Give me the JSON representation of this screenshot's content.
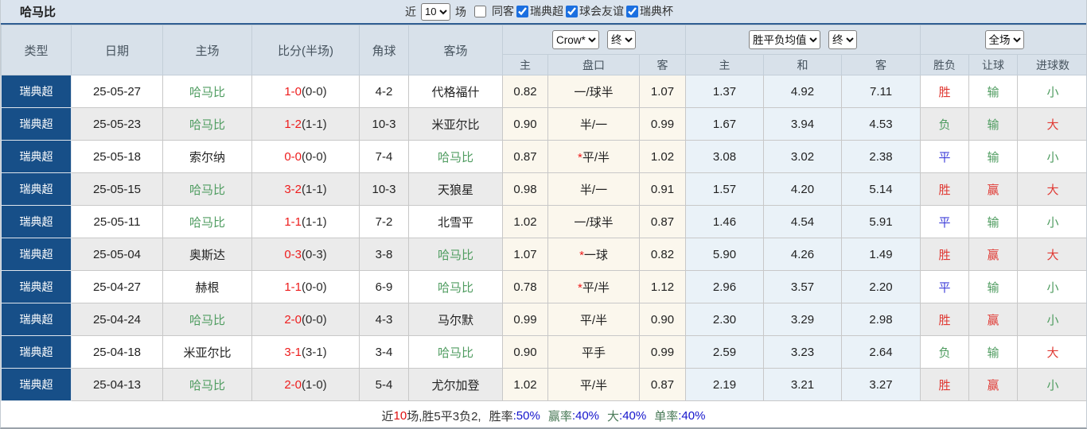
{
  "title": "哈马比",
  "topbar": {
    "recent_label": "近",
    "recent_select": "10",
    "matches_label": "场",
    "checkboxes": [
      {
        "label": "同客",
        "checked": false
      },
      {
        "label": "瑞典超",
        "checked": true
      },
      {
        "label": "球会友谊",
        "checked": true
      },
      {
        "label": "瑞典杯",
        "checked": true
      }
    ]
  },
  "table": {
    "main_headers": [
      "类型",
      "日期",
      "主场",
      "比分(半场)",
      "角球",
      "客场"
    ],
    "odds_group": {
      "select1": "Crow*",
      "select2": "终",
      "cols": [
        "主",
        "盘口",
        "客"
      ]
    },
    "mean_group": {
      "select1": "胜平负均值",
      "select2": "终",
      "cols": [
        "主",
        "和",
        "客"
      ]
    },
    "result_group": {
      "select": "全场",
      "cols": [
        "胜负",
        "让球",
        "进球数"
      ]
    },
    "rows": [
      {
        "league": "瑞典超",
        "date": "25-05-27",
        "home": "哈马比",
        "home_hl": true,
        "score_ft": "1-0",
        "score_ht": "(0-0)",
        "corners": "4-2",
        "away": "代格福什",
        "away_hl": false,
        "odds_home": "0.82",
        "handicap": "一/球半",
        "handicap_star": false,
        "odds_away": "1.07",
        "mean_home": "1.37",
        "mean_draw": "4.92",
        "mean_away": "7.11",
        "result": "胜",
        "result_color": "red",
        "handicap_result": "输",
        "handicap_result_color": "green",
        "goals": "小",
        "goals_color": "green"
      },
      {
        "league": "瑞典超",
        "date": "25-05-23",
        "home": "哈马比",
        "home_hl": true,
        "score_ft": "1-2",
        "score_ht": "(1-1)",
        "corners": "10-3",
        "away": "米亚尔比",
        "away_hl": false,
        "odds_home": "0.90",
        "handicap": "半/一",
        "handicap_star": false,
        "odds_away": "0.99",
        "mean_home": "1.67",
        "mean_draw": "3.94",
        "mean_away": "4.53",
        "result": "负",
        "result_color": "green",
        "handicap_result": "输",
        "handicap_result_color": "green",
        "goals": "大",
        "goals_color": "red"
      },
      {
        "league": "瑞典超",
        "date": "25-05-18",
        "home": "索尔纳",
        "home_hl": false,
        "score_ft": "0-0",
        "score_ht": "(0-0)",
        "corners": "7-4",
        "away": "哈马比",
        "away_hl": true,
        "odds_home": "0.87",
        "handicap": "平/半",
        "handicap_star": true,
        "odds_away": "1.02",
        "mean_home": "3.08",
        "mean_draw": "3.02",
        "mean_away": "2.38",
        "result": "平",
        "result_color": "blue",
        "handicap_result": "输",
        "handicap_result_color": "green",
        "goals": "小",
        "goals_color": "green"
      },
      {
        "league": "瑞典超",
        "date": "25-05-15",
        "home": "哈马比",
        "home_hl": true,
        "score_ft": "3-2",
        "score_ht": "(1-1)",
        "corners": "10-3",
        "away": "天狼星",
        "away_hl": false,
        "odds_home": "0.98",
        "handicap": "半/一",
        "handicap_star": false,
        "odds_away": "0.91",
        "mean_home": "1.57",
        "mean_draw": "4.20",
        "mean_away": "5.14",
        "result": "胜",
        "result_color": "red",
        "handicap_result": "赢",
        "handicap_result_color": "red",
        "goals": "大",
        "goals_color": "red"
      },
      {
        "league": "瑞典超",
        "date": "25-05-11",
        "home": "哈马比",
        "home_hl": true,
        "score_ft": "1-1",
        "score_ht": "(1-1)",
        "corners": "7-2",
        "away": "北雪平",
        "away_hl": false,
        "odds_home": "1.02",
        "handicap": "一/球半",
        "handicap_star": false,
        "odds_away": "0.87",
        "mean_home": "1.46",
        "mean_draw": "4.54",
        "mean_away": "5.91",
        "result": "平",
        "result_color": "blue",
        "handicap_result": "输",
        "handicap_result_color": "green",
        "goals": "小",
        "goals_color": "green"
      },
      {
        "league": "瑞典超",
        "date": "25-05-04",
        "home": "奥斯达",
        "home_hl": false,
        "score_ft": "0-3",
        "score_ht": "(0-3)",
        "corners": "3-8",
        "away": "哈马比",
        "away_hl": true,
        "odds_home": "1.07",
        "handicap": "一球",
        "handicap_star": true,
        "odds_away": "0.82",
        "mean_home": "5.90",
        "mean_draw": "4.26",
        "mean_away": "1.49",
        "result": "胜",
        "result_color": "red",
        "handicap_result": "赢",
        "handicap_result_color": "red",
        "goals": "大",
        "goals_color": "red"
      },
      {
        "league": "瑞典超",
        "date": "25-04-27",
        "home": "赫根",
        "home_hl": false,
        "score_ft": "1-1",
        "score_ht": "(0-0)",
        "corners": "6-9",
        "away": "哈马比",
        "away_hl": true,
        "odds_home": "0.78",
        "handicap": "平/半",
        "handicap_star": true,
        "odds_away": "1.12",
        "mean_home": "2.96",
        "mean_draw": "3.57",
        "mean_away": "2.20",
        "result": "平",
        "result_color": "blue",
        "handicap_result": "输",
        "handicap_result_color": "green",
        "goals": "小",
        "goals_color": "green"
      },
      {
        "league": "瑞典超",
        "date": "25-04-24",
        "home": "哈马比",
        "home_hl": true,
        "score_ft": "2-0",
        "score_ht": "(0-0)",
        "corners": "4-3",
        "away": "马尔默",
        "away_hl": false,
        "odds_home": "0.99",
        "handicap": "平/半",
        "handicap_star": false,
        "odds_away": "0.90",
        "mean_home": "2.30",
        "mean_draw": "3.29",
        "mean_away": "2.98",
        "result": "胜",
        "result_color": "red",
        "handicap_result": "赢",
        "handicap_result_color": "red",
        "goals": "小",
        "goals_color": "green"
      },
      {
        "league": "瑞典超",
        "date": "25-04-18",
        "home": "米亚尔比",
        "home_hl": false,
        "score_ft": "3-1",
        "score_ht": "(3-1)",
        "corners": "3-4",
        "away": "哈马比",
        "away_hl": true,
        "odds_home": "0.90",
        "handicap": "平手",
        "handicap_star": false,
        "odds_away": "0.99",
        "mean_home": "2.59",
        "mean_draw": "3.23",
        "mean_away": "2.64",
        "result": "负",
        "result_color": "green",
        "handicap_result": "输",
        "handicap_result_color": "green",
        "goals": "大",
        "goals_color": "red"
      },
      {
        "league": "瑞典超",
        "date": "25-04-13",
        "home": "哈马比",
        "home_hl": true,
        "score_ft": "2-0",
        "score_ht": "(1-0)",
        "corners": "5-4",
        "away": "尤尔加登",
        "away_hl": false,
        "odds_home": "1.02",
        "handicap": "平/半",
        "handicap_star": false,
        "odds_away": "0.87",
        "mean_home": "2.19",
        "mean_draw": "3.21",
        "mean_away": "3.27",
        "result": "胜",
        "result_color": "red",
        "handicap_result": "赢",
        "handicap_result_color": "red",
        "goals": "小",
        "goals_color": "green"
      }
    ]
  },
  "footer": {
    "segments": [
      {
        "text": "近",
        "cls": "t"
      },
      {
        "text": "10",
        "cls": "red"
      },
      {
        "text": "场,胜5平3负2,",
        "cls": "t"
      },
      {
        "text": "胜率",
        "cls": "lbl"
      },
      {
        "text": ":50%",
        "cls": "val"
      },
      {
        "text": "赢率",
        "cls": "lbl-g"
      },
      {
        "text": ":40%",
        "cls": "val"
      },
      {
        "text": "大",
        "cls": "lbl-g"
      },
      {
        "text": ":40%",
        "cls": "val"
      },
      {
        "text": "单率",
        "cls": "lbl-g"
      },
      {
        "text": ":40%",
        "cls": "val"
      }
    ]
  },
  "colors": {
    "league_cell_bg": "#174f88",
    "header_bg": "#d8e1ea",
    "row_alt_bg": "#ebebeb",
    "odds_col_bg": "#fbf7ed",
    "mean_col_bg": "#eaf2f8",
    "win_red": "#e03a34",
    "team_green": "#4f9c60",
    "draw_blue": "#4040d9",
    "score_red": "#ee1c1c",
    "footer_value_blue": "#1414cc",
    "topbar_border": "#2f5d92"
  }
}
